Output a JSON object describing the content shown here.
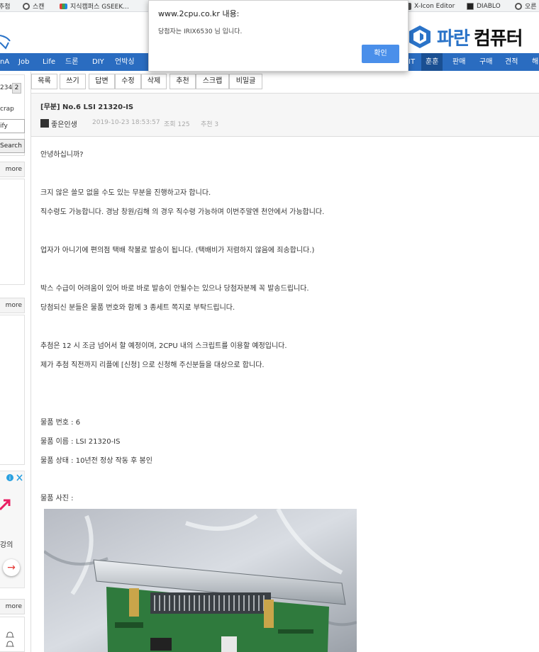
{
  "bookmarks": [
    {
      "label": "추첨",
      "icon": "none"
    },
    {
      "label": "스캔",
      "icon": "globe-icon"
    },
    {
      "label": "지식캠퍼스 GSEEK...",
      "icon": "gseek-icon"
    },
    {
      "label": "X-Icon Editor",
      "icon": "x-icon-editor-icon"
    },
    {
      "label": "DIABLO",
      "icon": "diablo-icon"
    },
    {
      "label": "오른",
      "icon": "globe-icon"
    }
  ],
  "brand": {
    "part1": "파란",
    "part2": "컴퓨터",
    "accent": "#2a73c8"
  },
  "nav": {
    "left_items": [
      "nA",
      "Job",
      "Life",
      "드론",
      "DIY",
      "언박싱"
    ],
    "right_items": [
      "IT",
      "훈훈",
      "판매",
      "구매",
      "견적",
      "해"
    ],
    "active": "훈훈",
    "bg_color": "#2a6cc0"
  },
  "sidebar": {
    "pager": {
      "prev": "234",
      "current": "2"
    },
    "scrap": "crap",
    "notify": "ify",
    "search_button": "Search",
    "more_label": "more",
    "ad_text": "강의",
    "ad_arrow": "→"
  },
  "toolbar": [
    "목록",
    "쓰기",
    "답변",
    "수정",
    "삭제",
    "추천",
    "스크랩",
    "비밀글"
  ],
  "post": {
    "title": "[무분] No.6 LSI 21320-IS",
    "author": "좋은인생",
    "date": "2019-10-23 18:53:57",
    "views": "조회 125",
    "likes": "추천 3",
    "lines": [
      "안녕하십니까?",
      "크지 않은 쓸모 없을 수도 있는 무분을 진행하고자 합니다.",
      "직수령도 가능합니다. 경남 창원/김해 의 경우 직수령 가능하며 이번주말엔 천안에서 가능합니다.",
      "업자가 아니기에 편의점 택배 착불로 발송이 됩니다. (택배비가 저렴하지 않음에 죄송합니다.)",
      "박스 수급이 어려움이 있어 바로 바로 발송이 안될수는 있으나 당첨자분께 꼭 발송드립니다.",
      "당첨되신 분들은 물품 번호와 함께 3 종세트 쪽지로 부탁드립니다.",
      "추첨은 12 시 조금 넘어서 할 예정이며, 2CPU 내의 스크립트를 이용할 예정입니다.",
      "제가 추첨 직전까지 리플에 [신청] 으로 신청해 주신분들을 대상으로 합니다.",
      "물품 번호 : 6",
      "물품 이름 : LSI 21320-IS",
      "물품 상태 :  10년전 정상 작동 후 봉인",
      "물품 사진 :"
    ]
  },
  "dialog": {
    "title": "www.2cpu.co.kr 내용:",
    "message": "당첨자는 IRIX6530 님 입니다.",
    "ok_label": "확인",
    "ok_color": "#4a8fea"
  }
}
